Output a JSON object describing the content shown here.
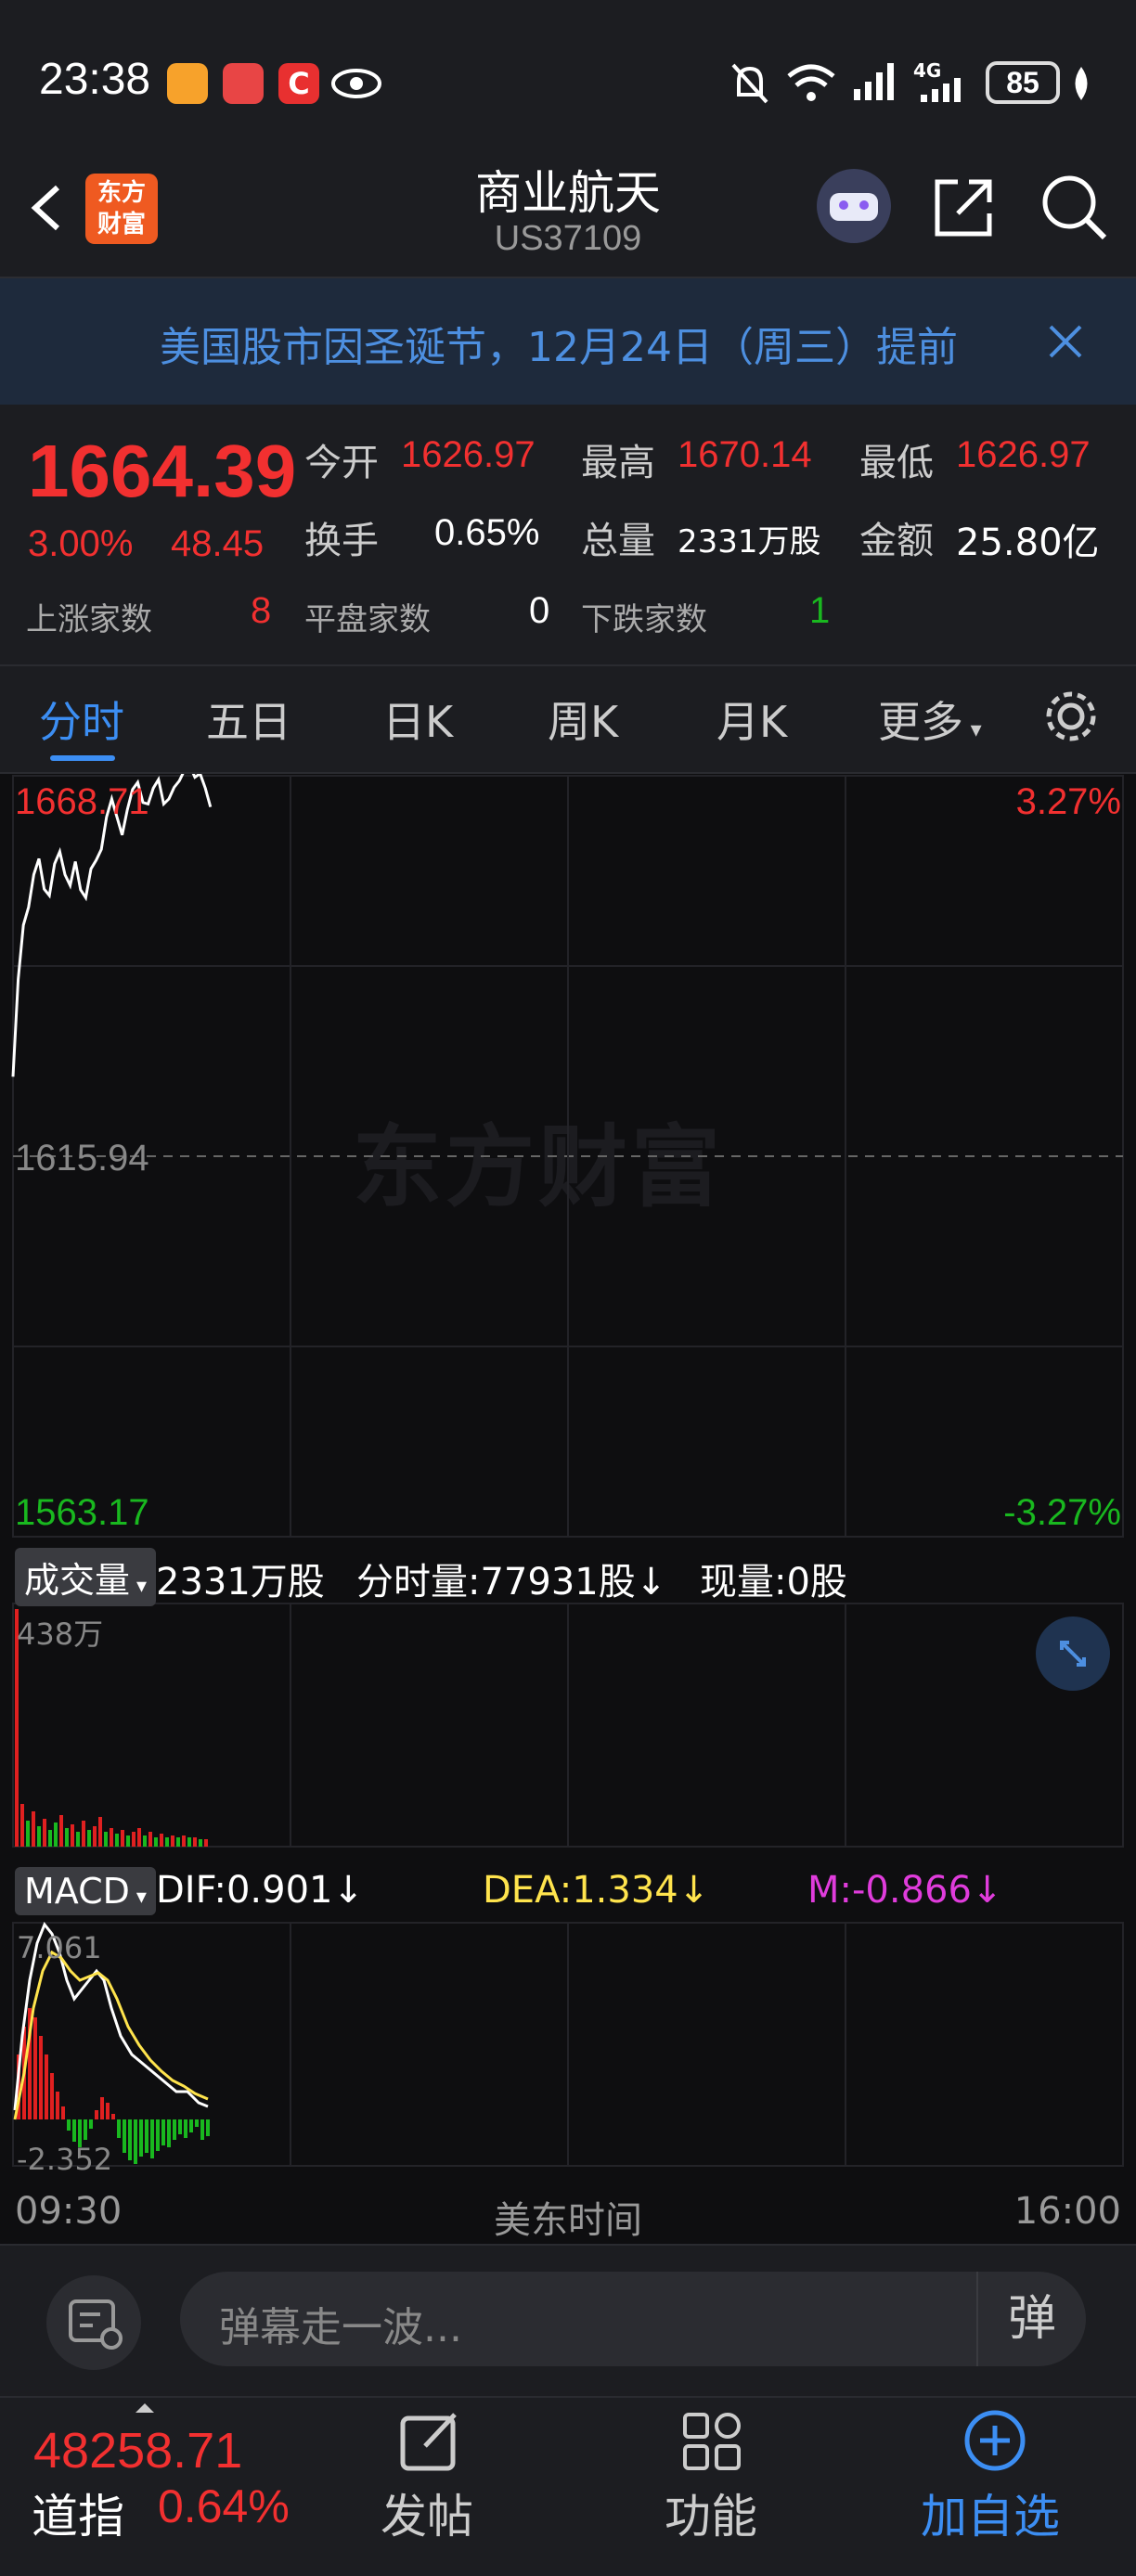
{
  "status_bar": {
    "time": "23:38",
    "battery": "85",
    "network": "4G"
  },
  "header": {
    "title": "商业航天",
    "code": "US37109",
    "logo_text": "东方\n财富"
  },
  "notice": {
    "text": "美国股市因圣诞节，12月24日（周三）提前"
  },
  "quote": {
    "price": "1664.39",
    "change_pct": "3.00%",
    "change": "48.45",
    "open_label": "今开",
    "open": "1626.97",
    "high_label": "最高",
    "high": "1670.14",
    "low_label": "最低",
    "low": "1626.97",
    "turnover_label": "换手",
    "turnover": "0.65%",
    "volume_label": "总量",
    "volume": "2331万股",
    "amount_label": "金额",
    "amount": "25.80亿",
    "up_label": "上涨家数",
    "up": "8",
    "flat_label": "平盘家数",
    "flat": "0",
    "down_label": "下跌家数",
    "down": "1"
  },
  "tabs": [
    "分时",
    "五日",
    "日K",
    "周K",
    "月K",
    "更多"
  ],
  "chart": {
    "watermark": "东方财富",
    "top_price": "1668.71",
    "top_pct": "3.27%",
    "mid_price": "1615.94",
    "bottom_price": "1563.17",
    "bottom_pct": "-3.27%",
    "volume_selector": "成交量",
    "volume_total": "2331万股",
    "minute_volume": "分时量:77931股↓",
    "current_volume": "现量:0股",
    "volume_max": "438万",
    "macd_selector": "MACD",
    "dif": "DIF:0.901↓",
    "dea": "DEA:1.334↓",
    "m": "M:-0.866↓",
    "macd_max": "7.061",
    "macd_min": "-2.352",
    "time_start": "09:30",
    "time_mid": "美东时间",
    "time_end": "16:00"
  },
  "chart_data": {
    "type": "line",
    "title": "",
    "ylim": [
      1563.17,
      1668.71
    ],
    "baseline": 1615.94,
    "x": [
      0,
      1,
      2,
      3,
      4,
      5,
      6,
      7,
      8,
      9,
      10,
      11,
      12,
      13,
      14,
      15,
      16,
      17,
      18,
      19,
      20,
      21,
      22,
      23,
      24,
      25,
      26,
      27,
      28,
      29,
      30,
      31,
      32,
      33,
      34,
      35,
      36,
      37,
      38
    ],
    "series": [
      {
        "values": [
          1626.97,
          1640.5,
          1648.0,
          1650.5,
          1655.0,
          1657.2,
          1653.0,
          1652.1,
          1656.5,
          1658.2,
          1655.0,
          1653.5,
          1656.8,
          1652.9,
          1651.8,
          1655.8,
          1657.0,
          1658.5,
          1663.0,
          1665.5,
          1663.0,
          1660.5,
          1664.0,
          1666.8,
          1667.8,
          1665.0,
          1664.8,
          1667.0,
          1668.2,
          1664.8,
          1665.5,
          1667.1,
          1668.0,
          1669.5,
          1670.14,
          1668.5,
          1669.0,
          1667.0,
          1664.39
        ]
      }
    ]
  },
  "input": {
    "placeholder": "弹幕走一波..."
  },
  "bottom_bar": {
    "index_value": "48258.71",
    "index_name": "道指",
    "index_pct": "0.64%",
    "post": "发帖",
    "functions": "功能",
    "add_watch": "加自选"
  },
  "colors": {
    "up": "#f23030",
    "down": "#19b81f",
    "accent": "#3c8ef3"
  }
}
